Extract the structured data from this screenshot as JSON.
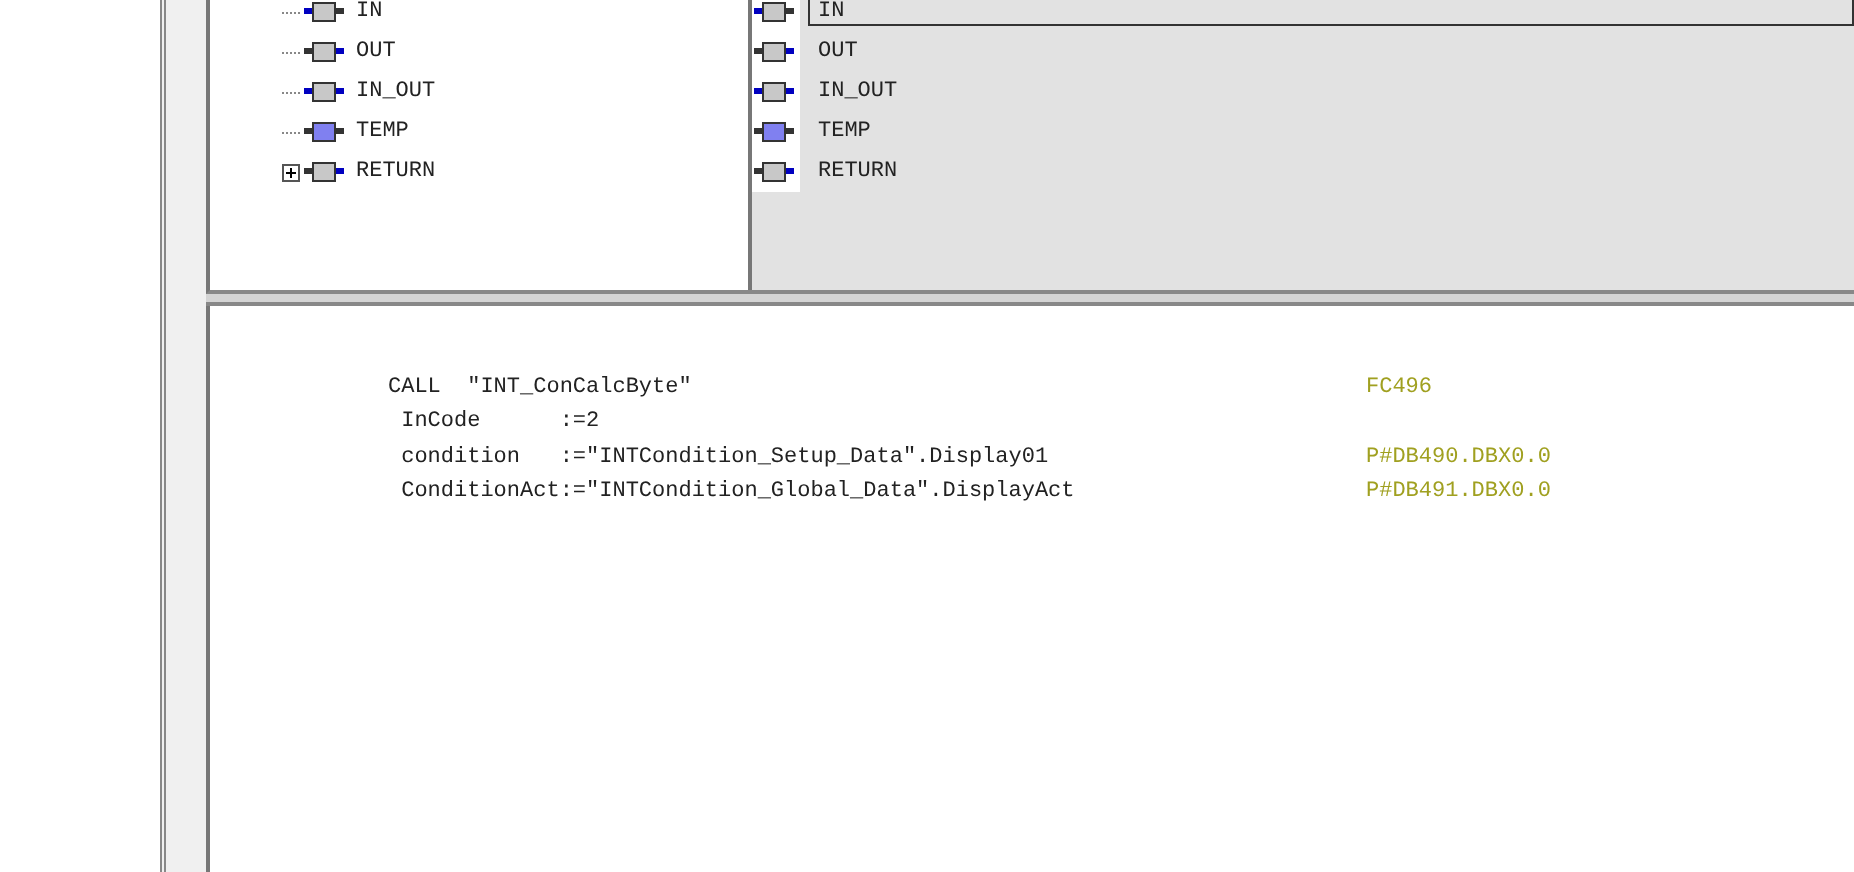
{
  "tree": [
    {
      "label": "IN",
      "kind": "in",
      "expandable": false
    },
    {
      "label": "OUT",
      "kind": "out",
      "expandable": false
    },
    {
      "label": "IN_OUT",
      "kind": "in_out",
      "expandable": false
    },
    {
      "label": "TEMP",
      "kind": "temp",
      "expandable": false
    },
    {
      "label": "RETURN",
      "kind": "out",
      "expandable": true
    }
  ],
  "list": [
    {
      "label": "IN",
      "kind": "in",
      "selected": true
    },
    {
      "label": "OUT",
      "kind": "out",
      "selected": false
    },
    {
      "label": "IN_OUT",
      "kind": "in_out",
      "selected": false
    },
    {
      "label": "TEMP",
      "kind": "temp",
      "selected": false
    },
    {
      "label": "RETURN",
      "kind": "out",
      "selected": false
    }
  ],
  "code": [
    {
      "text": "CALL  \"INT_ConCalcByte\"",
      "address": "FC496"
    },
    {
      "text": " InCode      :=2"
    },
    {
      "text": " condition   :=\"INTCondition_Setup_Data\".Display01",
      "address": "P#DB490.DBX0.0"
    },
    {
      "text": " ConditionAct:=\"INTCondition_Global_Data\".DisplayAct",
      "address": "P#DB491.DBX0.0"
    }
  ]
}
